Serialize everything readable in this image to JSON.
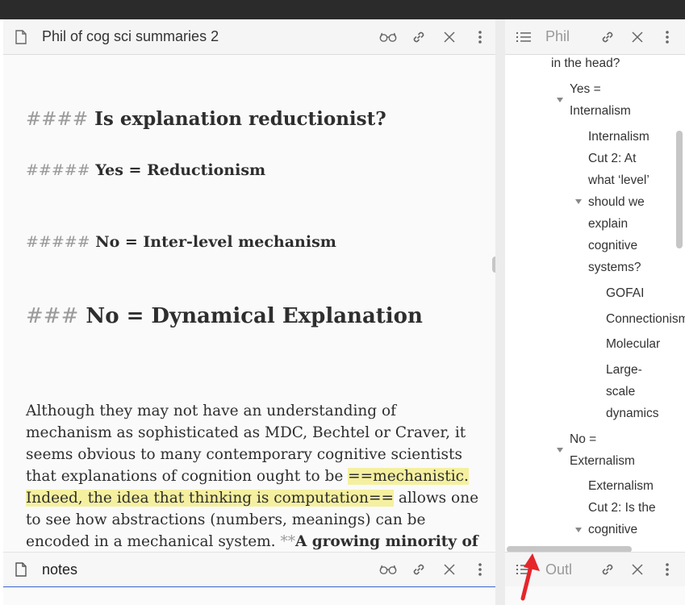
{
  "left_pane": {
    "title": "Phil of cog sci summaries 2",
    "heading_h4": {
      "marker": "####",
      "text": "Is explanation reductionist?"
    },
    "heading_h5_yes": {
      "marker": "#####",
      "text": "Yes = Reductionism"
    },
    "heading_h5_no": {
      "marker": "#####",
      "text": "No = Inter-level mechanism"
    },
    "heading_h3": {
      "marker": "###",
      "text": "No = Dynamical Explanation"
    },
    "paragraph": {
      "line1": "Although they may not have an understanding of",
      "line2": "mechanism as sophisticated as MDC, Bechtel or Craver, it",
      "line3": "seems obvious to many contemporary cognitive scientists",
      "line4_plain": "that explanations of cognition ought to be ",
      "line4_hl": "==mechanistic.",
      "line5_hl": "Indeed, the idea that thinking is computation==",
      "line5_plain": " allows one",
      "line6": "to see how abstractions (numbers, meanings) can be",
      "line7_plain": "encoded in a mechanical system. ",
      "line7_marker": "**",
      "line7_bold": "A growing minority of"
    }
  },
  "notes_pane": {
    "title": "notes"
  },
  "right_pane": {
    "title": "Phil",
    "footer_title": "Outl",
    "outline": [
      {
        "label": "in the head?"
      },
      {
        "label": "Yes ="
      },
      {
        "label": "Internalism"
      },
      {
        "label": "Internalism"
      },
      {
        "label": "Cut 2: At"
      },
      {
        "label": "what ‘level’"
      },
      {
        "label": "should we"
      },
      {
        "label": "explain"
      },
      {
        "label": "cognitive"
      },
      {
        "label": "systems?"
      },
      {
        "label": "GOFAI"
      },
      {
        "label": "Connectionism"
      },
      {
        "label": "Molecular"
      },
      {
        "label": "Large-"
      },
      {
        "label": "scale"
      },
      {
        "label": "dynamics"
      },
      {
        "label": "No ="
      },
      {
        "label": "Externalism"
      },
      {
        "label": "Externalism"
      },
      {
        "label": "Cut 2: Is the"
      },
      {
        "label": "cognitive"
      }
    ]
  },
  "icons": {
    "file": "file-icon",
    "reading_view": "glasses-icon",
    "link": "link-icon",
    "close": "close-icon",
    "more": "more-options-icon",
    "outline": "list-icon"
  },
  "colors": {
    "highlight": "#f5f0a0",
    "active_tab_underline": "#3a63c8",
    "annotation_arrow": "#e5262b"
  }
}
